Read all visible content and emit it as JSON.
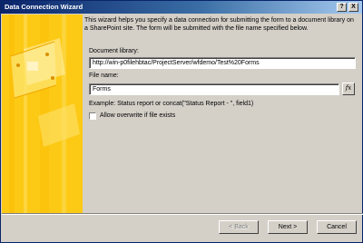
{
  "window": {
    "title": "Data Connection Wizard"
  },
  "titlebar_buttons": {
    "help": "?",
    "close": "X"
  },
  "intro": "This wizard helps you specify a data connection for submitting the form to a document library on a SharePoint site. The form will be submitted with the file name specified below.",
  "fields": {
    "library_label": "Document library:",
    "library_value": "http://win-p0filehbtac/ProjectServer/wfdemo/Test%20Forms",
    "filename_label": "File name:",
    "filename_value": "Forms",
    "fx_label": "fx"
  },
  "example": "Example: Status report or concat(\"Status Report - \", field1)",
  "allow_overwrite": {
    "label": "Allow overwrite if file exists",
    "checked": false
  },
  "buttons": {
    "back": "< Back",
    "next": "Next >",
    "cancel": "Cancel"
  },
  "colors": {
    "panel": "#fcc914",
    "titlebar_start": "#0a246a",
    "titlebar_end": "#a6caf0",
    "dialog": "#d4d0c8"
  }
}
